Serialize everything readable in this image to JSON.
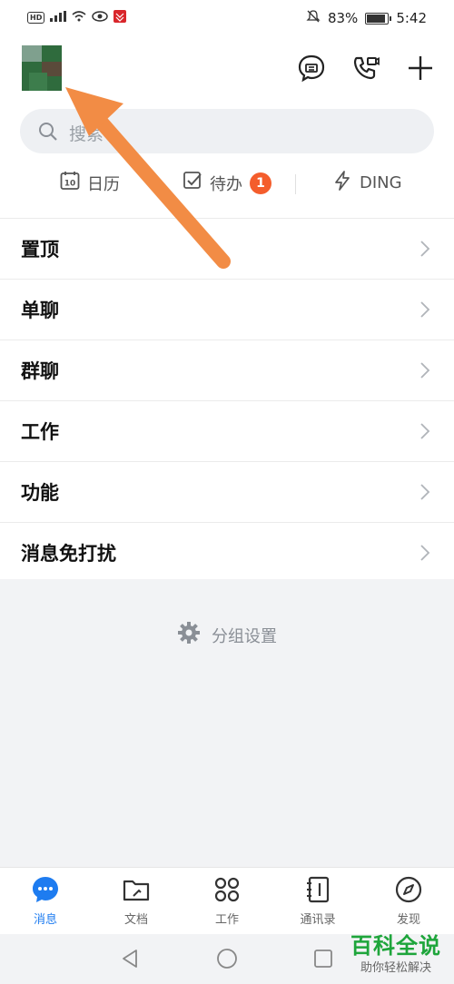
{
  "status_bar": {
    "indicators": "HD ⁴ᴳ",
    "battery": "83%",
    "time": "5:42"
  },
  "header": {
    "icons": [
      "secret-chat-icon",
      "video-call-icon",
      "add-icon"
    ]
  },
  "search": {
    "placeholder": "搜索"
  },
  "quick_links": {
    "calendar": "日历",
    "todo": "待办",
    "todo_badge": "1",
    "ding": "DING"
  },
  "list": {
    "items": [
      {
        "label": "置顶"
      },
      {
        "label": "单聊"
      },
      {
        "label": "群聊"
      },
      {
        "label": "工作"
      },
      {
        "label": "功能"
      },
      {
        "label": "消息免打扰"
      }
    ]
  },
  "group_settings": {
    "label": "分组设置"
  },
  "tabs": [
    {
      "label": "消息"
    },
    {
      "label": "文档"
    },
    {
      "label": "工作"
    },
    {
      "label": "通讯录"
    },
    {
      "label": "发现"
    }
  ],
  "colors": {
    "accent": "#1e7cf0",
    "badge": "#f45d2c",
    "arrow": "#f28c45",
    "watermark": "#1ea53b"
  },
  "watermark": {
    "main": "百科全说",
    "sub": "助你轻松解决"
  }
}
